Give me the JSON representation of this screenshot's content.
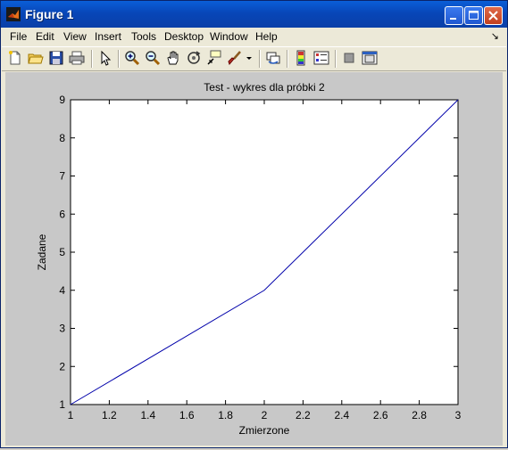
{
  "window": {
    "title": "Figure 1"
  },
  "menu": {
    "items": [
      "File",
      "Edit",
      "View",
      "Insert",
      "Tools",
      "Desktop",
      "Window",
      "Help"
    ]
  },
  "toolbar": {
    "icons": [
      "new-figure-icon",
      "open-file-icon",
      "save-icon",
      "print-icon",
      "edit-plot-arrow-icon",
      "zoom-in-icon",
      "zoom-out-icon",
      "pan-hand-icon",
      "rotate-3d-icon",
      "data-cursor-icon",
      "brush-icon",
      "brush-dropdown-icon",
      "link-plot-icon",
      "colorbar-icon",
      "legend-icon",
      "hide-plot-tools-icon",
      "show-plot-tools-icon"
    ]
  },
  "chart_data": {
    "type": "line",
    "title": "Test - wykres dla próbki 2",
    "xlabel": "Zmierzone",
    "ylabel": "Zadane",
    "xlim": [
      1,
      3
    ],
    "ylim": [
      1,
      9
    ],
    "xticks": [
      "1",
      "1.2",
      "1.4",
      "1.6",
      "1.8",
      "2",
      "2.2",
      "2.4",
      "2.6",
      "2.8",
      "3"
    ],
    "yticks": [
      "1",
      "2",
      "3",
      "4",
      "5",
      "6",
      "7",
      "8",
      "9"
    ],
    "series": [
      {
        "x": [
          1,
          2,
          3
        ],
        "y": [
          1,
          4,
          9
        ],
        "color": "#0000aa"
      }
    ],
    "grid": false
  }
}
